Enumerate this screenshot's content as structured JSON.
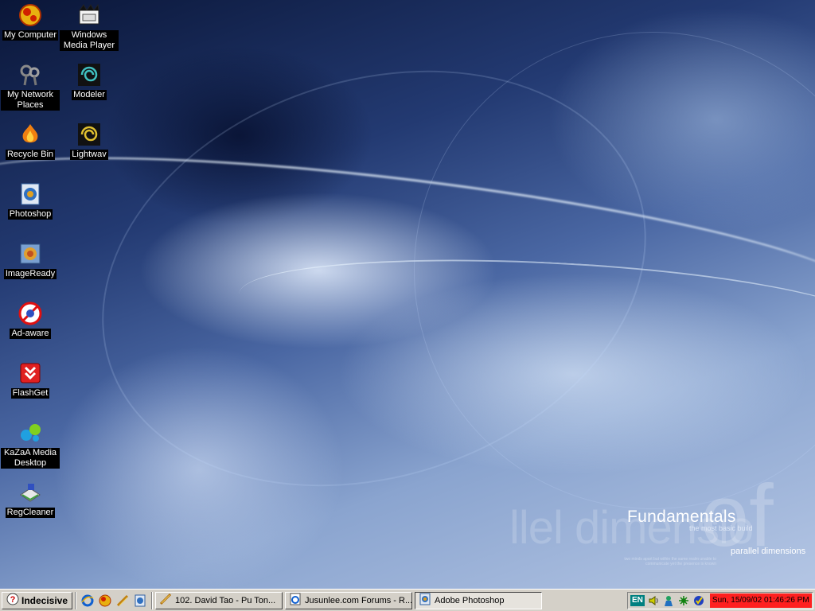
{
  "desktop": {
    "icons": [
      {
        "label": "My Computer",
        "icon": "my-computer-icon"
      },
      {
        "label": "Windows Media Player",
        "icon": "media-player-icon"
      },
      {
        "label": "My Network Places",
        "icon": "network-places-icon"
      },
      {
        "label": "Modeler",
        "icon": "modeler-icon"
      },
      {
        "label": "Recycle Bin",
        "icon": "recycle-bin-icon"
      },
      {
        "label": "Lightwav",
        "icon": "lightwave-icon"
      },
      {
        "label": "Photoshop",
        "icon": "photoshop-icon"
      },
      {
        "label": "ImageReady",
        "icon": "imageready-icon"
      },
      {
        "label": "Ad-aware",
        "icon": "adaware-icon"
      },
      {
        "label": "FlashGet",
        "icon": "flashget-icon"
      },
      {
        "label": "KaZaA Media Desktop",
        "icon": "kazaa-icon"
      },
      {
        "label": "RegCleaner",
        "icon": "regcleaner-icon"
      }
    ]
  },
  "wallpaper": {
    "title": "Fundamentals",
    "subtitle": "the most basic build",
    "tagline": "parallel dimensions",
    "ghost_text": "llel dimensio",
    "ghost_big": "of",
    "fine_print": "two minds apart but within the same realm unable to communicate yet the presence is known"
  },
  "taskbar": {
    "start_label": "Indecisive",
    "quick_launch": [
      "internet-explorer-icon",
      "my-computer-icon",
      "lightwave-icon",
      "photoshop-icon"
    ],
    "tasks": [
      {
        "label": "102. David Tao - Pu Ton...",
        "icon": "winamp-icon",
        "active": false
      },
      {
        "label": "Jusunlee.com Forums - R...",
        "icon": "browser-page-icon",
        "active": false
      },
      {
        "label": "Adobe Photoshop",
        "icon": "photoshop-icon",
        "active": true
      }
    ],
    "tray": {
      "language": "EN",
      "icons": [
        "volume-icon",
        "messenger-icon",
        "network-icon",
        "norton-icon"
      ],
      "clock": "Sun, 15/09/02 01:46:26 PM"
    }
  },
  "colors": {
    "taskbar_bg": "#d4d0c8",
    "clock_bg": "#ff2020",
    "language_bg": "#008080"
  }
}
